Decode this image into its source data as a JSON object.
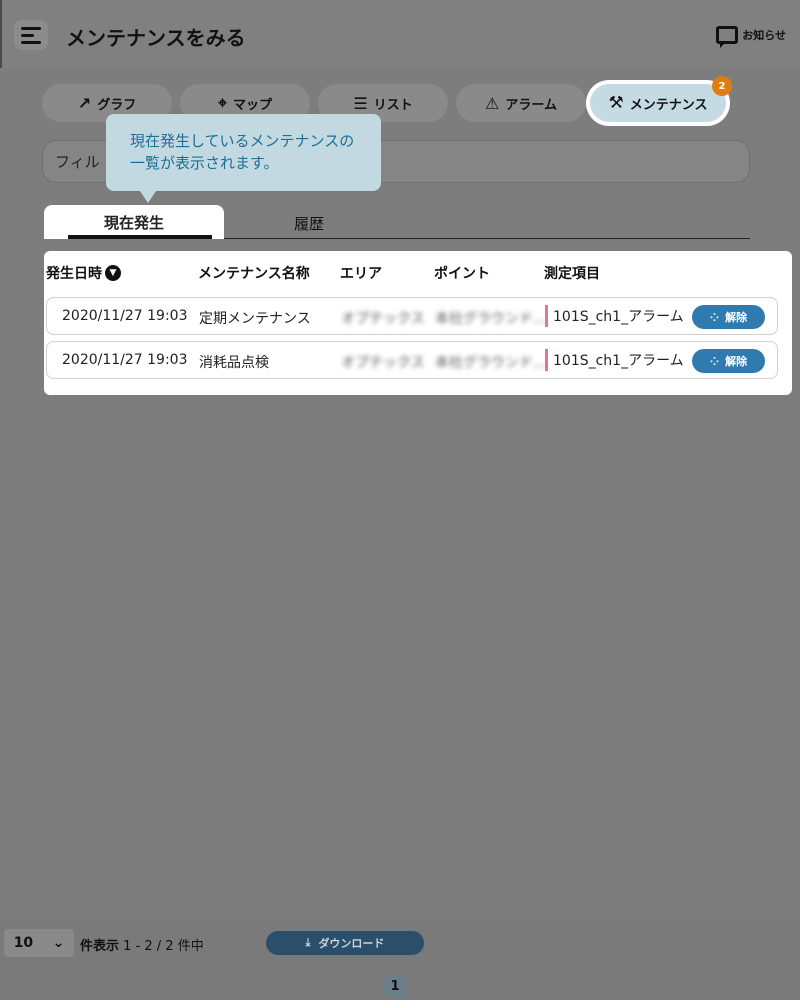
{
  "header": {
    "title": "メンテナンスをみる",
    "notice_label": "お知らせ"
  },
  "nav_tabs": [
    {
      "icon": "chart-line-icon",
      "glyph": "↗",
      "label": "グラフ"
    },
    {
      "icon": "map-pin-icon",
      "glyph": "⌖",
      "label": "マップ"
    },
    {
      "icon": "list-icon",
      "glyph": "☰",
      "label": "リスト"
    },
    {
      "icon": "warning-icon",
      "glyph": "⚠",
      "label": "アラーム"
    }
  ],
  "nav_active": {
    "icon": "tools-icon",
    "glyph": "⚒",
    "label": "メンテナンス",
    "badge": "2"
  },
  "filter": {
    "placeholder": "フィル"
  },
  "tooltip": {
    "line1": "現在発生しているメンテナンスの",
    "line2": "一覧が表示されます。"
  },
  "subtabs": {
    "current": "現在発生",
    "history": "履歴"
  },
  "table": {
    "headers": {
      "datetime": "発生日時",
      "name": "メンテナンス名称",
      "area": "エリア",
      "point": "ポイント",
      "measure": "測定項目"
    },
    "rows": [
      {
        "datetime": "2020/11/27 19:03",
        "name": "定期メンテナンス",
        "area": "オプテックス",
        "point": "本社グラウンド…",
        "measure": "101S_ch1_アラーム",
        "action": "解除"
      },
      {
        "datetime": "2020/11/27 19:03",
        "name": "消耗品点検",
        "area": "オプテックス",
        "point": "本社グラウンド…",
        "measure": "101S_ch1_アラーム",
        "action": "解除"
      }
    ]
  },
  "footer": {
    "page_size": "10",
    "page_size_suffix": "件表示",
    "range": "1 - 2 / 2 件中",
    "download_label": "ダウンロード",
    "current_page": "1"
  },
  "colors": {
    "accent": "#2f7bb0",
    "badge": "#e07d10",
    "measure_marker": "#e0778f",
    "tooltip_bg": "#c3d9e1",
    "tooltip_text": "#1c6f93"
  }
}
